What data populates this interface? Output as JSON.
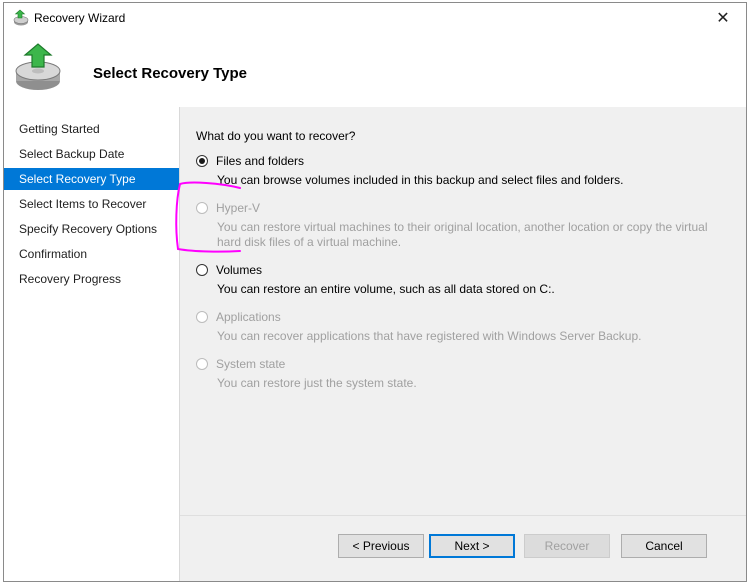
{
  "window": {
    "title": "Recovery Wizard",
    "close_glyph": "✕"
  },
  "header": {
    "title": "Select Recovery Type",
    "icon": "recovery-disk-icon"
  },
  "steps": [
    {
      "label": "Getting Started"
    },
    {
      "label": "Select Backup Date"
    },
    {
      "label": "Select Recovery Type"
    },
    {
      "label": "Select Items to Recover"
    },
    {
      "label": "Specify Recovery Options"
    },
    {
      "label": "Confirmation"
    },
    {
      "label": "Recovery Progress"
    }
  ],
  "active_step": "Select Recovery Type",
  "content": {
    "question": "What do you want to recover?",
    "options": [
      {
        "label": "Files and folders",
        "description": "You can browse volumes included in this backup and select files and folders.",
        "checked": true,
        "enabled": true
      },
      {
        "label": "Hyper-V",
        "description": "You can restore virtual machines to their original location, another location or copy the virtual hard disk files of a virtual machine.",
        "checked": false,
        "enabled": false
      },
      {
        "label": "Volumes",
        "description": "You can restore an entire volume, such as all data stored on C:.",
        "checked": false,
        "enabled": true
      },
      {
        "label": "Applications",
        "description": "You can recover applications that have registered with Windows Server Backup.",
        "checked": false,
        "enabled": false
      },
      {
        "label": "System state",
        "description": "You can restore just the system state.",
        "checked": false,
        "enabled": false
      }
    ]
  },
  "buttons": {
    "previous": "< Previous",
    "next": "Next >",
    "recover": "Recover",
    "cancel": "Cancel"
  },
  "colors": {
    "accent": "#0078d7",
    "annotation": "#ff00ff",
    "disabled_text": "#a0a0a0"
  }
}
